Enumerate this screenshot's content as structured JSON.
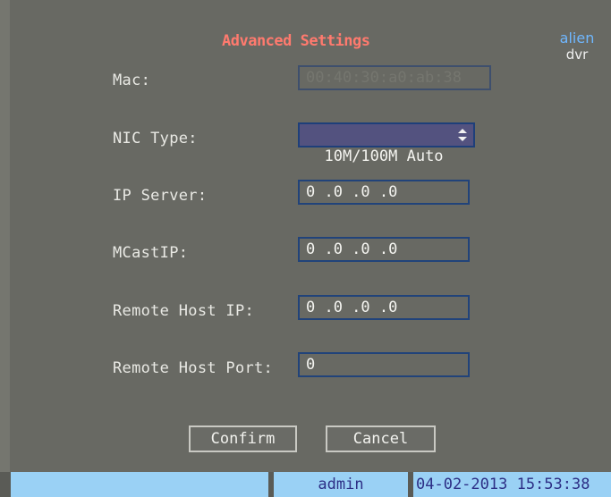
{
  "dialog": {
    "title": "Advanced Settings",
    "logo": {
      "line1": "alien",
      "line2": "dvr"
    }
  },
  "fields": {
    "mac": {
      "label": "Mac:",
      "value": "00:40:30:a0:ab:38"
    },
    "nic_type": {
      "label": "NIC Type:",
      "value": "10M/100M Auto"
    },
    "ip_server": {
      "label": "IP Server:",
      "value": "0 .0 .0 .0"
    },
    "mcast_ip": {
      "label": "MCastIP:",
      "value": "0 .0 .0 .0"
    },
    "remote_host_ip": {
      "label": "Remote Host IP:",
      "value": "0 .0 .0 .0"
    },
    "remote_host_port": {
      "label": "Remote Host Port:",
      "value": "0"
    }
  },
  "buttons": {
    "confirm": "Confirm",
    "cancel": "Cancel"
  },
  "status_bar": {
    "user": "admin",
    "datetime": "04-02-2013 15:53:38"
  },
  "colors": {
    "title": "#ff7a6e",
    "logo": "#6fb7ff",
    "status_bg": "#9ad1f5",
    "status_text": "#2d2f86"
  }
}
